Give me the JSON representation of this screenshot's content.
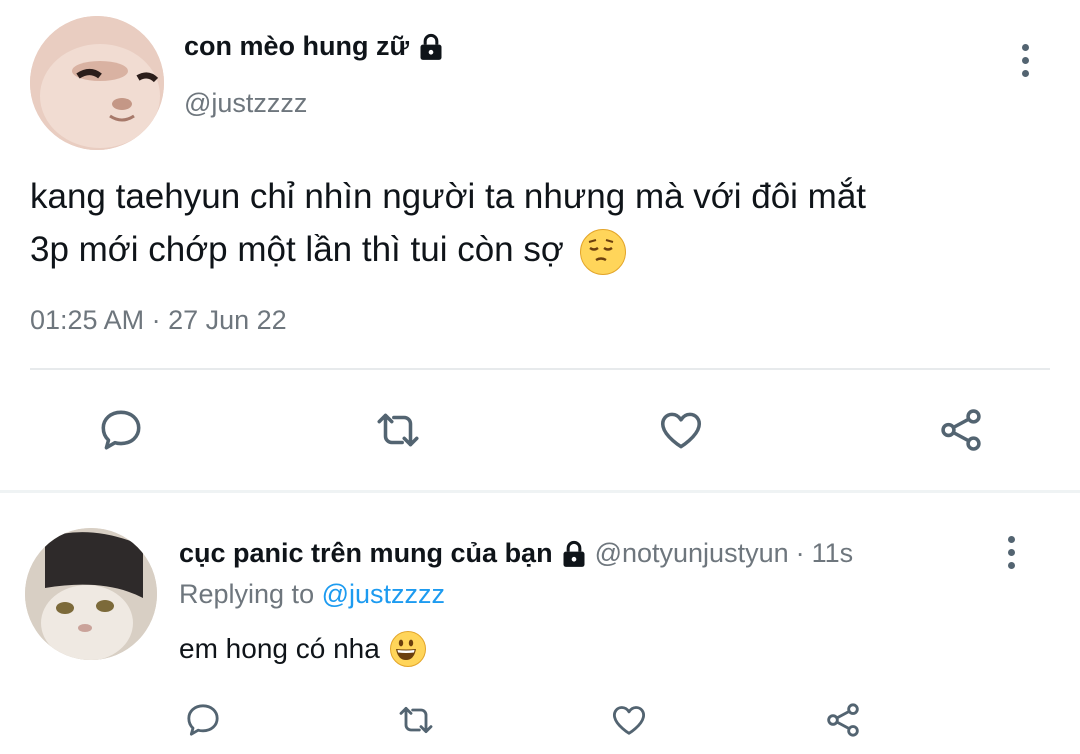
{
  "tweet": {
    "author_name": "con mèo hung zữ",
    "author_handle": "@justzzzz",
    "text_line1": "kang taehyun chỉ nhìn người ta nhưng mà với đôi mắt",
    "text_line2": "3p mới chớp một lần thì tui còn sợ",
    "text_emoji": "pensive-face",
    "time": "01:25 AM",
    "separator": " · ",
    "date": "27 Jun 22",
    "actions": [
      "reply-icon",
      "retweet-icon",
      "like-icon",
      "share-icon"
    ]
  },
  "reply": {
    "author_name": "cục panic trên mung của bạn",
    "author_handle": "@notyunjustyun",
    "separator": " · ",
    "time_ago": "11s",
    "replying_prefix": "Replying to ",
    "replying_to": "@justzzzz",
    "text": "em hong có nha",
    "text_emoji": "grinning-face",
    "actions": [
      "reply-icon",
      "retweet-icon",
      "like-icon",
      "share-icon"
    ]
  },
  "colors": {
    "text": "#0f1419",
    "secondary": "#6e767d",
    "link": "#1d9bf0",
    "icon": "#536471",
    "divider": "#e7eaec"
  }
}
